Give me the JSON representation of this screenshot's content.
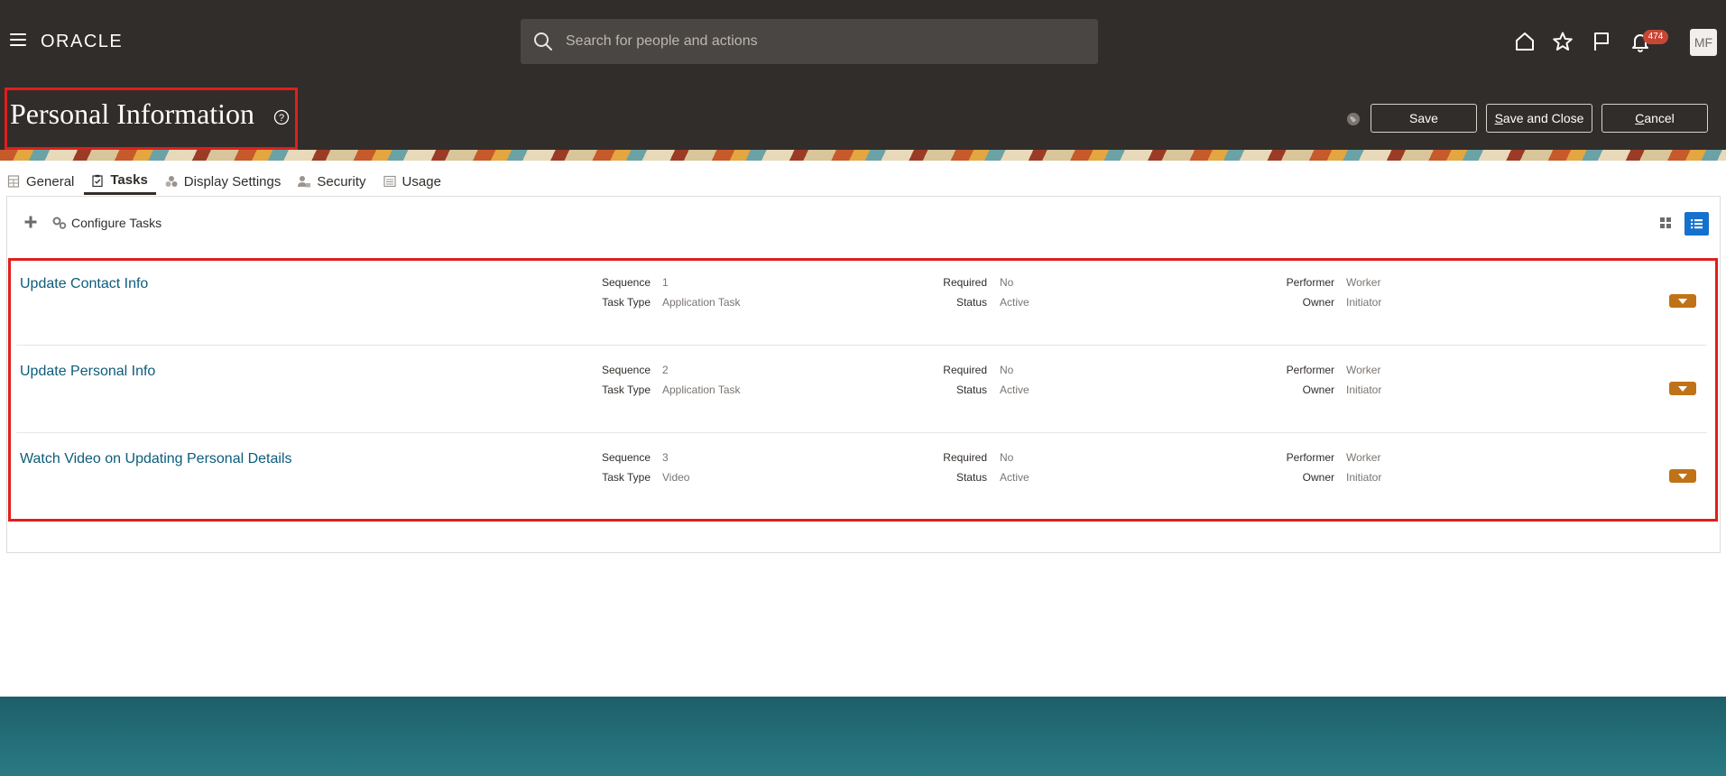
{
  "header": {
    "logo": "ORACLE",
    "search_placeholder": "Search for people and actions",
    "notifications_count": "474",
    "avatar_initials": "MF"
  },
  "page": {
    "title": "Personal Information",
    "buttons": {
      "save": "Save",
      "save_and_close_prefix": "S",
      "save_and_close_rest": "ave and Close",
      "cancel_prefix": "C",
      "cancel_rest": "ancel"
    }
  },
  "tabs": [
    {
      "label": "General",
      "icon": "table-icon"
    },
    {
      "label": "Tasks",
      "icon": "clipboard-check-icon",
      "active": true
    },
    {
      "label": "Display Settings",
      "icon": "shapes-icon"
    },
    {
      "label": "Security",
      "icon": "user-lock-icon"
    },
    {
      "label": "Usage",
      "icon": "document-icon"
    }
  ],
  "toolbar": {
    "configure_tasks": "Configure Tasks"
  },
  "tasks": {
    "labels": {
      "sequence": "Sequence",
      "task_type": "Task Type",
      "required": "Required",
      "status": "Status",
      "performer": "Performer",
      "owner": "Owner"
    },
    "rows": [
      {
        "name": "Update Contact Info",
        "sequence": "1",
        "task_type": "Application Task",
        "required": "No",
        "status": "Active",
        "performer": "Worker",
        "owner": "Initiator"
      },
      {
        "name": "Update Personal Info",
        "sequence": "2",
        "task_type": "Application Task",
        "required": "No",
        "status": "Active",
        "performer": "Worker",
        "owner": "Initiator"
      },
      {
        "name": "Watch Video on Updating Personal Details",
        "sequence": "3",
        "task_type": "Video",
        "required": "No",
        "status": "Active",
        "performer": "Worker",
        "owner": "Initiator"
      }
    ]
  },
  "colors": {
    "header_bg": "#312d2a",
    "link": "#0d5c7a",
    "action_button": "#c07216",
    "highlight_border": "#e01e1e",
    "active_view": "#1471cd"
  }
}
